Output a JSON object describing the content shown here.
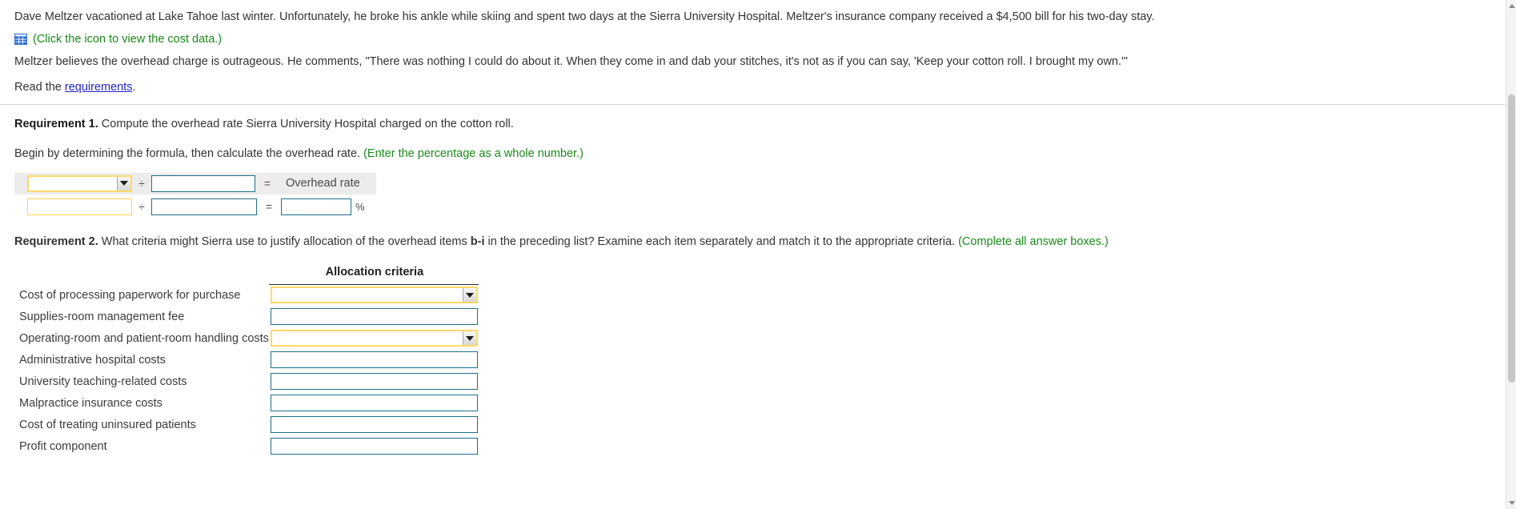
{
  "problem": {
    "paragraph1": "Dave Meltzer vacationed at Lake Tahoe last winter. Unfortunately, he broke his ankle while skiing and spent two days at the Sierra University Hospital. Meltzer's insurance company received a $4,500 bill for his two-day stay.",
    "cost_data_link": "(Click the icon to view the cost data.)",
    "paragraph2": "Meltzer believes the overhead charge is outrageous. He comments, \"There was nothing I could do about it. When they come in and dab your stitches, it's not as if you can say, 'Keep your cotton roll. I brought my own.'\"",
    "read_prefix": "Read the ",
    "read_link": "requirements",
    "read_suffix": "."
  },
  "requirement1": {
    "label": "Requirement 1.",
    "text": " Compute the overhead rate Sierra University Hospital charged on the cotton roll.",
    "instruction": "Begin by determining the formula, then calculate the overhead rate. ",
    "instruction_note": "(Enter the percentage as a whole number.)",
    "formula": {
      "divide_symbol": "÷",
      "equals_symbol": "=",
      "result_label": "Overhead rate",
      "percent_symbol": "%",
      "numerator_value": "",
      "denominator_value": "",
      "numerator_amount": "",
      "denominator_amount": "",
      "rate_value": ""
    }
  },
  "requirement2": {
    "label": "Requirement 2.",
    "text_part1": " What criteria might Sierra use to justify allocation of the overhead items ",
    "bold_items": "b-i",
    "text_part2": " in the preceding list? Examine each item separately and match it to the appropriate criteria. ",
    "note": "(Complete all answer boxes.)",
    "table": {
      "column_header": "Allocation criteria",
      "rows": [
        {
          "label": "Cost of processing paperwork for purchase",
          "value": "",
          "control": "dropdown",
          "highlight": "yellow"
        },
        {
          "label": "Supplies-room management fee",
          "value": "",
          "control": "text",
          "highlight": "teal"
        },
        {
          "label": "Operating-room and patient-room handling costs",
          "value": "",
          "control": "dropdown",
          "highlight": "yellow"
        },
        {
          "label": "Administrative hospital costs",
          "value": "",
          "control": "text",
          "highlight": "teal"
        },
        {
          "label": "University teaching-related costs",
          "value": "",
          "control": "text",
          "highlight": "teal"
        },
        {
          "label": "Malpractice insurance costs",
          "value": "",
          "control": "text",
          "highlight": "teal"
        },
        {
          "label": "Cost of treating uninsured patients",
          "value": "",
          "control": "text",
          "highlight": "teal"
        },
        {
          "label": "Profit component",
          "value": "",
          "control": "text",
          "highlight": "teal"
        }
      ]
    }
  },
  "colors": {
    "link": "#2222cc",
    "note_green": "#1a8a1a",
    "input_teal": "#1f6f8b",
    "input_yellow": "#ffd966",
    "icon_blue": "#2f6fd0"
  }
}
